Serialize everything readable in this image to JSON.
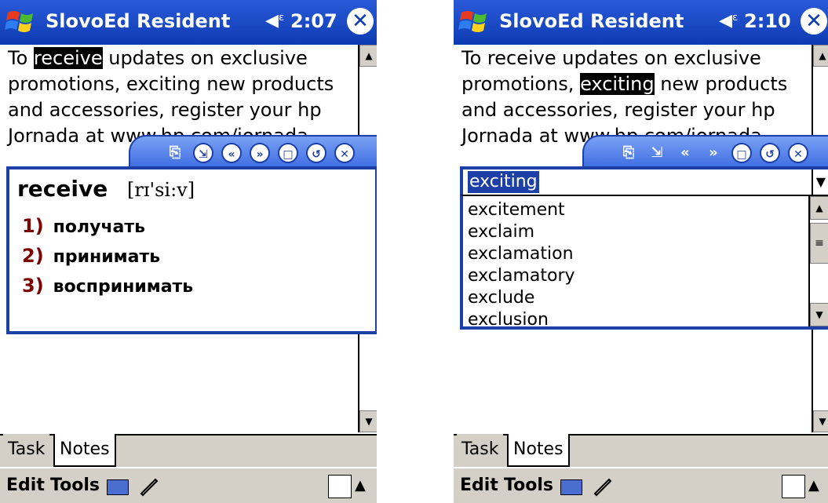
{
  "left": {
    "title": "SlovoEd Resident",
    "time": "2:07",
    "note_lines": [
      {
        "pre": "To ",
        "hl": "receive",
        "post": " updates on exclusive"
      },
      {
        "pre": "promotions, exciting new products",
        "hl": "",
        "post": ""
      },
      {
        "pre": "and accessories, register your hp",
        "hl": "",
        "post": ""
      },
      {
        "pre": "Jornada at www.hp.com/jornada",
        "hl": "",
        "post": ""
      }
    ],
    "headword": "receive",
    "transcription": "[rɪ'si:v]",
    "senses": [
      {
        "num": "1)",
        "text": "получать"
      },
      {
        "num": "2)",
        "text": "принимать"
      },
      {
        "num": "3)",
        "text": "воспринимать"
      }
    ],
    "tabs": [
      "Task",
      "Notes"
    ],
    "menu": {
      "edit": "Edit",
      "tools": "Tools"
    }
  },
  "right": {
    "title": "SlovoEd Resident",
    "time": "2:10",
    "note_lines": [
      {
        "pre": "To receive updates on exclusive",
        "hl": "",
        "post": ""
      },
      {
        "pre": "promotions, ",
        "hl": "exciting",
        "post": " new products"
      },
      {
        "pre": "and accessories, register your hp",
        "hl": "",
        "post": ""
      },
      {
        "pre": "Jornada at www.hp.com/jornada",
        "hl": "",
        "post": ""
      }
    ],
    "search_value": "exciting",
    "list_items": [
      "excitement",
      "exclaim",
      "exclamation",
      "exclamatory",
      "exclude",
      "exclusion"
    ],
    "tabs": [
      "Task",
      "Notes"
    ],
    "menu": {
      "edit": "Edit",
      "tools": "Tools"
    }
  },
  "colors": {
    "titlebar": "#0d3bb3",
    "popup_border": "#1c3fa8",
    "sense_number": "#7a0000"
  }
}
